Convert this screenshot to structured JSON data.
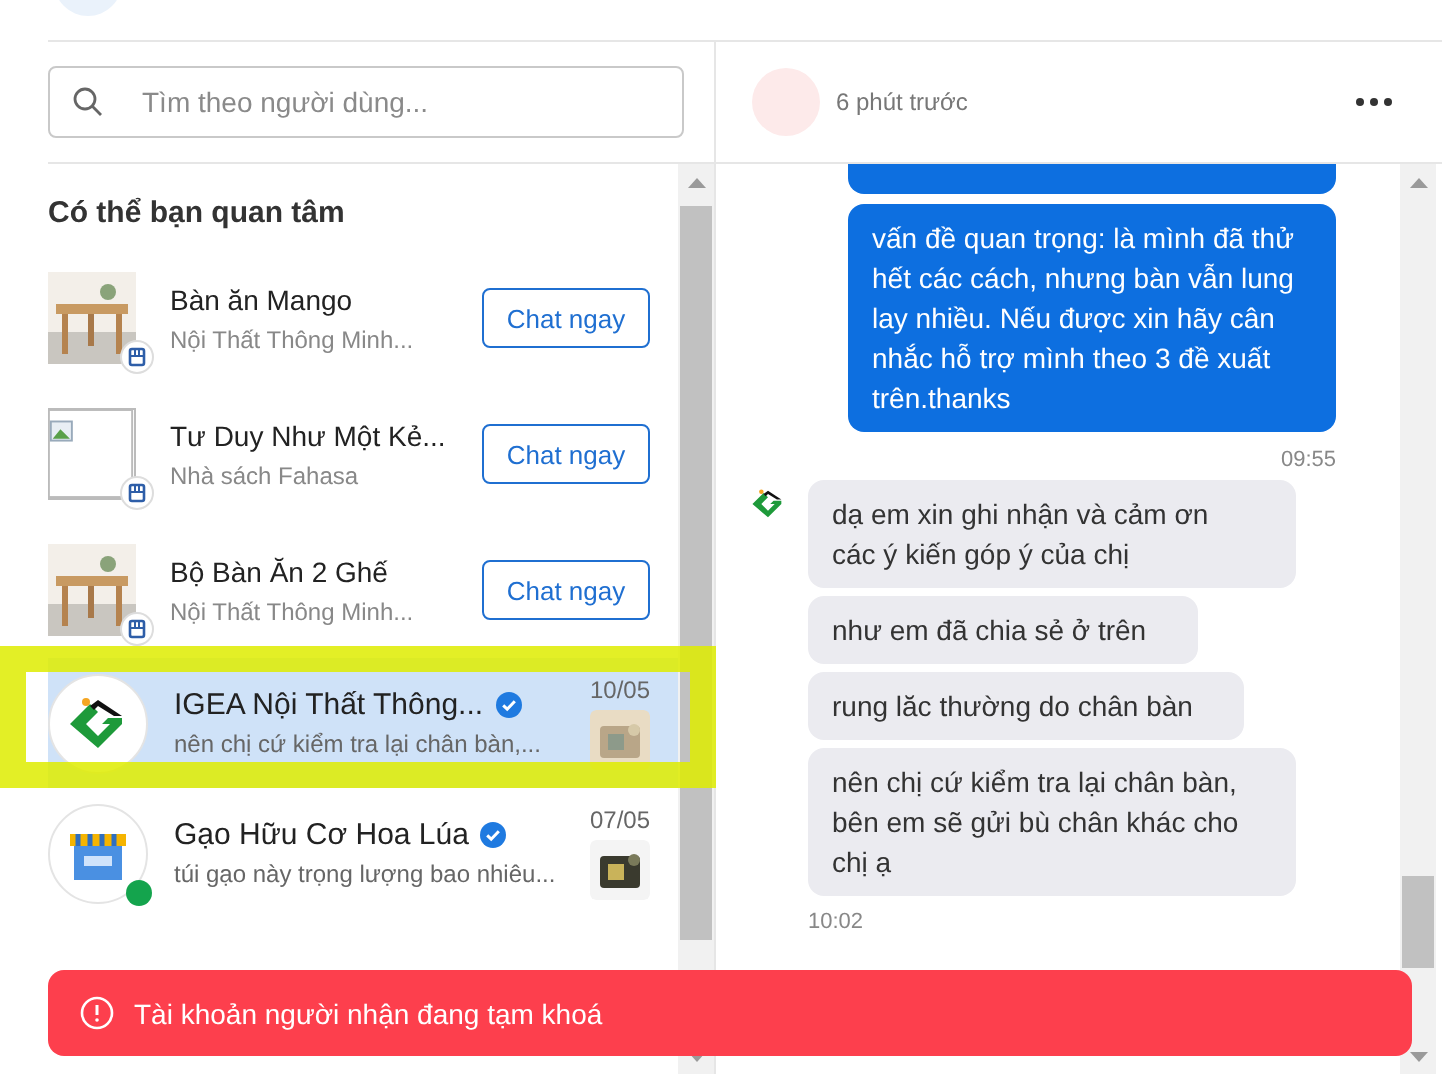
{
  "search": {
    "placeholder": "Tìm theo người dùng..."
  },
  "suggestions": {
    "title": "Có thể bạn quan tâm",
    "items": [
      {
        "name": "Bàn ăn Mango",
        "shop": "Nội Thất Thông Minh...",
        "kind": "picture",
        "button": "Chat ngay"
      },
      {
        "name": "Tư Duy Như Một Kẻ...",
        "shop": "Nhà sách Fahasa",
        "kind": "broken",
        "button": "Chat ngay"
      },
      {
        "name": "Bộ Bàn Ăn 2 Ghế",
        "shop": "Nội Thất Thông Minh...",
        "kind": "picture",
        "button": "Chat ngay"
      }
    ]
  },
  "conversations": [
    {
      "name": "IGEA Nội Thất Thông...",
      "verified": true,
      "preview": "nên chị cứ kiểm tra lại chân bàn,...",
      "date": "10/05",
      "kind": "logo",
      "online": false,
      "selected": true,
      "highlighted": true
    },
    {
      "name": "Gạo Hữu Cơ Hoa Lúa",
      "verified": true,
      "preview": "túi gạo này trọng lượng bao nhiêu...",
      "date": "07/05",
      "kind": "shop",
      "online": true,
      "selected": false,
      "highlighted": false
    }
  ],
  "chat": {
    "time": "6 phút trước",
    "groups": [
      {
        "kind": "out",
        "time": "09:55",
        "bubbles": [
          {
            "kind": "cut"
          },
          {
            "kind": "text",
            "text": "vấn đề quan trọng: là mình đã thử hết các cách, nhưng bàn vẫn lung lay nhiều. Nếu được xin hãy cân nhắc hỗ trợ mình theo 3 đề xuất trên.thanks"
          }
        ]
      },
      {
        "kind": "in",
        "time": "10:02",
        "bubbles": [
          {
            "kind": "text",
            "text": "dạ em xin ghi nhận và cảm ơn các ý kiến góp ý của chị"
          },
          {
            "kind": "text",
            "text": "như em đã chia sẻ ở trên"
          },
          {
            "kind": "text",
            "text": "rung lăc thường do chân bàn"
          },
          {
            "kind": "text",
            "text": "nên chị cứ kiểm tra lại chân bàn, bên em sẽ gửi bù chân khác cho chị ạ"
          }
        ]
      }
    ]
  },
  "toast": {
    "kind": "error",
    "text": "Tài khoản người nhận đang tạm khoá"
  }
}
